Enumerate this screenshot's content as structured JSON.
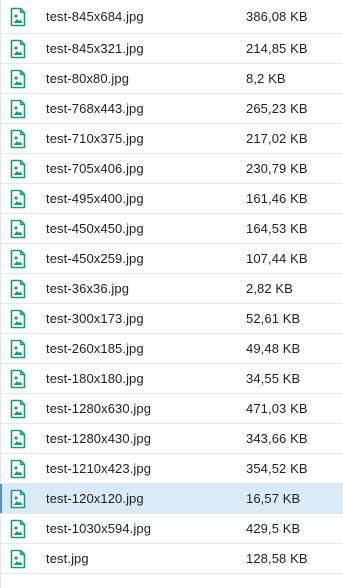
{
  "accent_colors": {
    "icon_green": "#1d9a78",
    "selection_bg": "#dbeaf7",
    "selection_bar": "#5a8fc6",
    "divider": "#e6e6e6"
  },
  "files": [
    {
      "name": "test-845x684.jpg",
      "size": "386,08 KB",
      "icon": "image-file-icon"
    },
    {
      "name": "test-845x321.jpg",
      "size": "214,85 KB",
      "icon": "image-file-icon"
    },
    {
      "name": "test-80x80.jpg",
      "size": "8,2 KB",
      "icon": "image-file-icon"
    },
    {
      "name": "test-768x443.jpg",
      "size": "265,23 KB",
      "icon": "image-file-icon"
    },
    {
      "name": "test-710x375.jpg",
      "size": "217,02 KB",
      "icon": "image-file-icon"
    },
    {
      "name": "test-705x406.jpg",
      "size": "230,79 KB",
      "icon": "image-file-icon"
    },
    {
      "name": "test-495x400.jpg",
      "size": "161,46 KB",
      "icon": "image-file-icon"
    },
    {
      "name": "test-450x450.jpg",
      "size": "164,53 KB",
      "icon": "image-file-icon"
    },
    {
      "name": "test-450x259.jpg",
      "size": "107,44 KB",
      "icon": "image-file-icon"
    },
    {
      "name": "test-36x36.jpg",
      "size": "2,82 KB",
      "icon": "image-file-icon"
    },
    {
      "name": "test-300x173.jpg",
      "size": "52,61 KB",
      "icon": "image-file-icon"
    },
    {
      "name": "test-260x185.jpg",
      "size": "49,48 KB",
      "icon": "image-file-icon"
    },
    {
      "name": "test-180x180.jpg",
      "size": "34,55 KB",
      "icon": "image-file-icon"
    },
    {
      "name": "test-1280x630.jpg",
      "size": "471,03 KB",
      "icon": "image-file-icon"
    },
    {
      "name": "test-1280x430.jpg",
      "size": "343,66 KB",
      "icon": "image-file-icon"
    },
    {
      "name": "test-1210x423.jpg",
      "size": "354,52 KB",
      "icon": "image-file-icon"
    },
    {
      "name": "test-120x120.jpg",
      "size": "16,57 KB",
      "icon": "image-file-icon",
      "selected": true
    },
    {
      "name": "test-1030x594.jpg",
      "size": "429,5 KB",
      "icon": "image-file-icon"
    },
    {
      "name": "test.jpg",
      "size": "128,58 KB",
      "icon": "image-file-icon"
    }
  ]
}
